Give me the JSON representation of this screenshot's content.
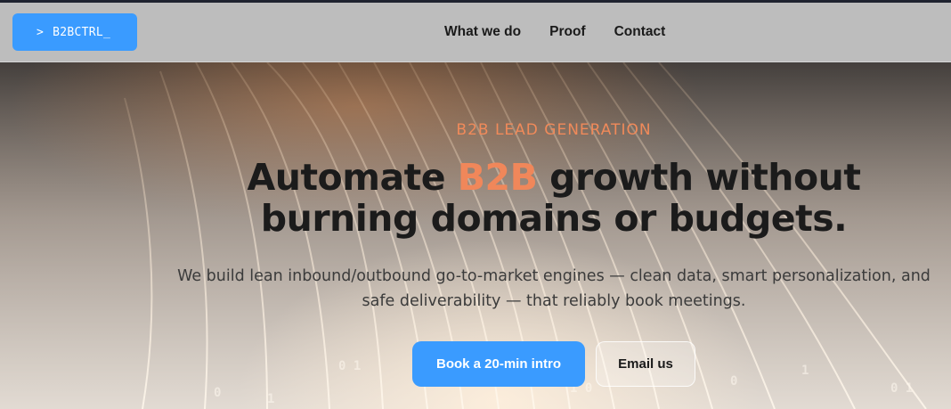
{
  "brand": {
    "caret": ">",
    "name": "B2BCTRL_"
  },
  "nav": {
    "items": [
      {
        "label": "What we do"
      },
      {
        "label": "Proof"
      },
      {
        "label": "Contact"
      }
    ]
  },
  "hero": {
    "eyebrow": "B2B LEAD GENERATION",
    "headline_pre": "Automate ",
    "headline_accent": "B2B",
    "headline_post": " growth without burning domains or budgets.",
    "subtitle": "We build lean inbound/outbound go-to-market engines — clean data, smart personalization, and safe deliverability — that reliably book meetings.",
    "primary_cta": "Book a 20-min intro",
    "secondary_cta": "Email us"
  },
  "colors": {
    "accent_blue": "#3a9bff",
    "accent_orange": "#f0875a",
    "nav_bg": "#bdbdbd"
  }
}
